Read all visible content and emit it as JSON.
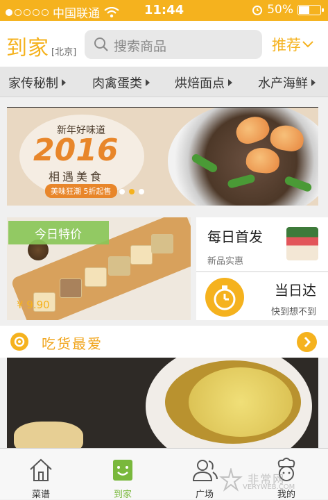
{
  "status_bar": {
    "carrier": "中国联通",
    "time": "11:44",
    "battery": "50%"
  },
  "header": {
    "logo": "到家",
    "city": "[北京]",
    "search_placeholder": "搜索商品",
    "recommend": "推荐"
  },
  "categories": [
    "家传秘制",
    "肉禽蛋类",
    "烘焙面点",
    "水产海鲜"
  ],
  "banner": {
    "line1": "新年好味道",
    "year": "2016",
    "line2": "相遇美食",
    "pill": "美味狂潮 5折起售"
  },
  "promo": {
    "tag": "今日特价",
    "price": "¥ 9.90"
  },
  "new_arrivals": {
    "title": "每日首发",
    "subtitle": "新品实惠"
  },
  "same_day": {
    "title": "当日达",
    "subtitle": "快到想不到"
  },
  "favorites": {
    "title": "吃货最爱"
  },
  "tabbar": {
    "tabs": [
      {
        "label": "菜谱",
        "icon": "home-icon"
      },
      {
        "label": "到家",
        "icon": "smile-bag-icon"
      },
      {
        "label": "广场",
        "icon": "users-icon"
      },
      {
        "label": "我的",
        "icon": "chef-icon"
      }
    ],
    "active_color": "#79b83c"
  },
  "watermark": {
    "text": "非常网",
    "en": "VERYWEB.COM"
  },
  "colors": {
    "brand": "#f5b21e",
    "green": "#8ac658"
  }
}
